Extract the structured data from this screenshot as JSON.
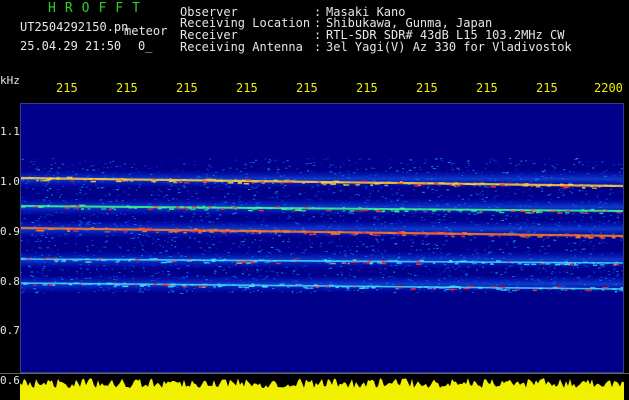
{
  "header": {
    "brand": "HROFFT",
    "filename": "UT2504292150.pn",
    "mode": "meteor",
    "timestamp": "25.04.29 21:50",
    "count": "0_",
    "labels": [
      "Observer",
      "Receiving Location",
      "Receiver",
      "Receiving Antenna"
    ],
    "separators": [
      ":",
      ":",
      ":",
      ":"
    ],
    "values": [
      "Masaki Kano",
      "Shibukawa, Gunma, Japan",
      "RTL-SDR SDR# 43dB L15 103.2MHz CW",
      "3el Yagi(V) Az 330 for Vladivostok"
    ]
  },
  "axis": {
    "unit": "kHz",
    "y_ticks": [
      "1.1",
      "1.0",
      "0.9",
      "0.8",
      "0.7",
      "0.6"
    ],
    "x_ticks": [
      "215",
      "215",
      "215",
      "215",
      "215",
      "215",
      "215",
      "215",
      "215",
      "2200"
    ]
  },
  "colors": {
    "background": "#000000",
    "plot_bg": "#00008a",
    "text": "#e6e6e6",
    "axis_text": "#f0f000",
    "brand": "#2ad02a",
    "power": "#f0f000"
  }
}
